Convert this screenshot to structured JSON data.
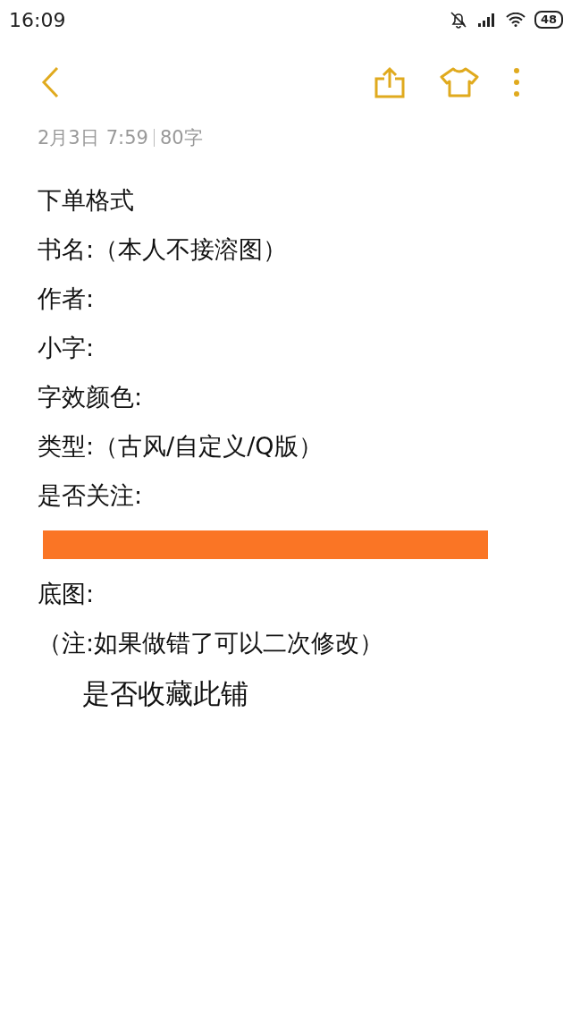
{
  "status_bar": {
    "time": "16:09",
    "battery": "48"
  },
  "note": {
    "date": "2月3日",
    "time": "7:59",
    "count": "80字",
    "lines": [
      {
        "kind": "text",
        "text": "下单格式"
      },
      {
        "kind": "text",
        "text": "书名:（本人不接溶图）"
      },
      {
        "kind": "text",
        "text": "作者:"
      },
      {
        "kind": "text",
        "text": "小字:"
      },
      {
        "kind": "text",
        "text": "字效颜色:"
      },
      {
        "kind": "text",
        "text": "类型:（古风/自定义/Q版）"
      },
      {
        "kind": "text",
        "text": "是否关注:"
      },
      {
        "kind": "redacted"
      },
      {
        "kind": "text",
        "text": "底图:"
      },
      {
        "kind": "text",
        "text": "（注:如果做错了可以二次修改）"
      },
      {
        "kind": "large",
        "text": "是否收藏此铺"
      }
    ]
  }
}
